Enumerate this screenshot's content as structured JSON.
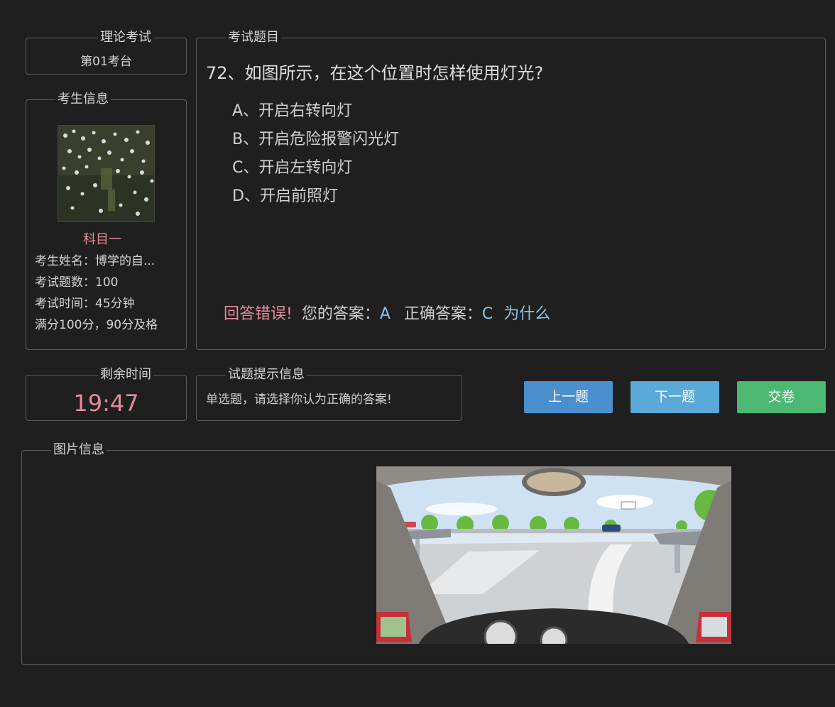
{
  "exam": {
    "legend": "理论考试",
    "seat": "第01考台"
  },
  "student": {
    "legend": "考生信息",
    "subject": "科目一",
    "name": "考生姓名：博学的自...",
    "count": "考试题数：100",
    "duration": "考试时间：45分钟",
    "score": "满分100分，90分及格"
  },
  "question": {
    "legend": "考试题目",
    "title": "72、如图所示，在这个位置时怎样使用灯光?",
    "options": [
      "A、开启右转向灯",
      "B、开启危险报警闪光灯",
      "C、开启左转向灯",
      "D、开启前照灯"
    ],
    "result": "回答错误!",
    "your_answer_label": "您的答案：",
    "your_answer": "A",
    "correct_label": "正确答案：",
    "correct_answer": "C",
    "why": "为什么"
  },
  "timer": {
    "legend": "剩余时间",
    "time": "19:47"
  },
  "hint": {
    "legend": "试题提示信息",
    "text": "单选题，请选择你认为正确的答案!"
  },
  "buttons": {
    "prev": "上一题",
    "next": "下一题",
    "submit": "交卷"
  },
  "image_panel": {
    "legend": "图片信息"
  },
  "colors": {
    "accent_pink": "#e48a9a",
    "accent_blue": "#8fc1e8",
    "btn_prev": "#4a8fce",
    "btn_next": "#5aa9d8",
    "btn_submit": "#4cb872"
  }
}
